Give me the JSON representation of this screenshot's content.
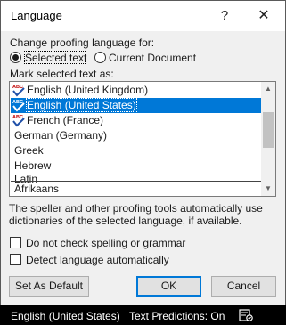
{
  "dialog": {
    "title": "Language",
    "help": "?",
    "close": "✕"
  },
  "proofing": {
    "label": "Change proofing language for:",
    "options": [
      "Selected text",
      "Current Document"
    ],
    "selected": "Selected text"
  },
  "mark": {
    "label": "Mark selected text as:",
    "items": [
      {
        "label": "English (United Kingdom)",
        "icon": "spellcheck-icon"
      },
      {
        "label": "English (United States)",
        "icon": "spellcheck-icon",
        "selected": true
      },
      {
        "label": "French (France)",
        "icon": "spellcheck-icon"
      },
      {
        "label": "German (Germany)"
      },
      {
        "label": "Greek"
      },
      {
        "label": "Hebrew"
      },
      {
        "label": "Latin"
      },
      {
        "label": "Afrikaans"
      }
    ]
  },
  "description": "The speller and other proofing tools automatically use dictionaries of the selected language, if available.",
  "checkboxes": {
    "no_check": {
      "label": "Do not check spelling or grammar",
      "checked": false
    },
    "detect": {
      "label": "Detect language automatically",
      "checked": false
    }
  },
  "buttons": {
    "set_default": "Set As Default",
    "ok": "OK",
    "cancel": "Cancel"
  },
  "statusbar": {
    "language": "English (United States)",
    "predictions": "Text Predictions: On",
    "icon": "accessibility-check-icon"
  },
  "colors": {
    "selection": "#0078d7",
    "accent_check": "#1f4fa8",
    "abc_red": "#c00000"
  }
}
